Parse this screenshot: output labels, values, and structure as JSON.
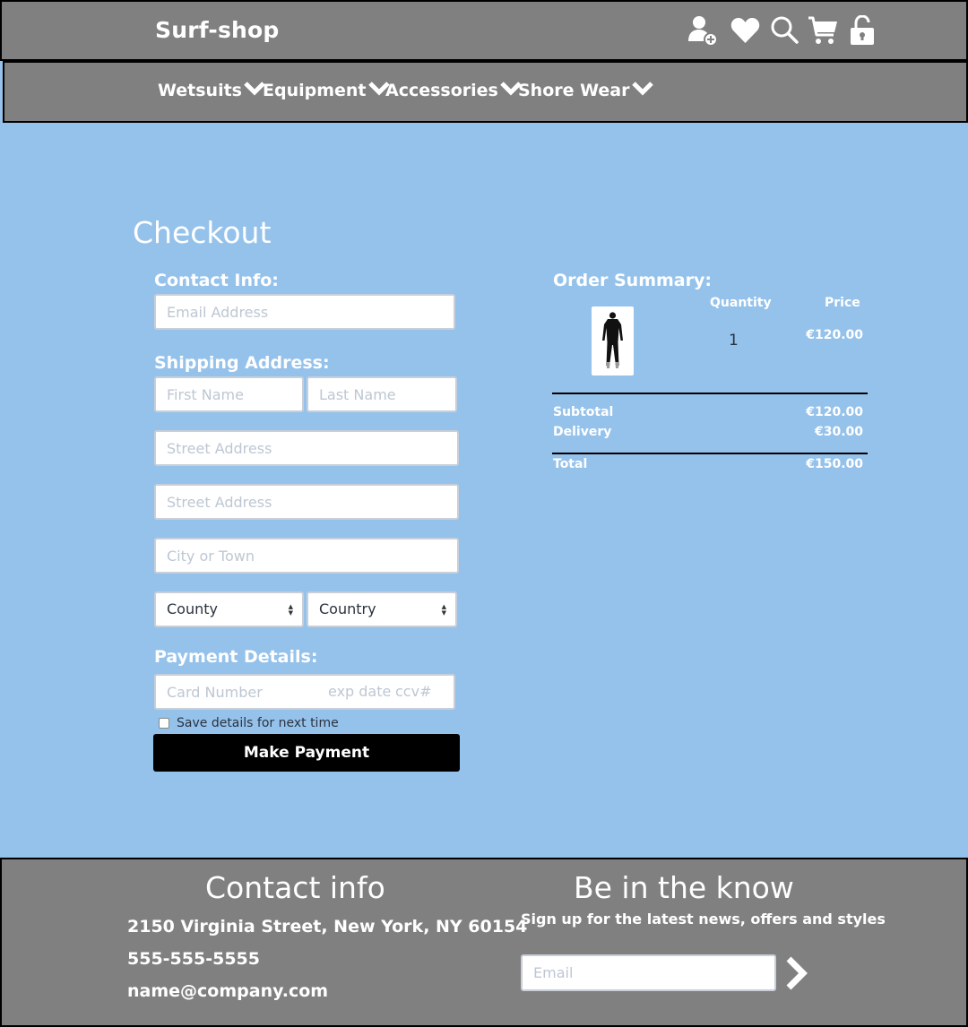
{
  "header": {
    "brand": "Surf-shop",
    "icons": [
      "add-user-icon",
      "heart-icon",
      "search-icon",
      "cart-icon",
      "unlock-icon"
    ]
  },
  "nav": {
    "items": [
      {
        "label": "Wetsuits"
      },
      {
        "label": "Equipment"
      },
      {
        "label": "Accessories"
      },
      {
        "label": "Shore Wear"
      }
    ]
  },
  "checkout": {
    "title": "Checkout",
    "contact_label": "Contact Info:",
    "email_placeholder": "Email Address",
    "shipping_label": "Shipping Address:",
    "first_name_placeholder": "First Name",
    "last_name_placeholder": "Last Name",
    "street1_placeholder": "Street Address",
    "street2_placeholder": "Street Address",
    "city_placeholder": "City or Town",
    "county_select": "County",
    "country_select": "Country",
    "payment_label": "Payment Details:",
    "card_placeholder": "Card Number",
    "exp_placeholder": "exp date",
    "ccv_placeholder": "ccv#",
    "save_details_label": "Save details for next time",
    "pay_button": "Make Payment"
  },
  "summary": {
    "title": "Order Summary:",
    "quantity_header": "Quantity",
    "price_header": "Price",
    "item": {
      "quantity": "1",
      "price": "€120.00",
      "image": "wetsuit-image"
    },
    "subtotal_label": "Subtotal",
    "subtotal_value": "€120.00",
    "delivery_label": "Delivery",
    "delivery_value": "€30.00",
    "total_label": "Total",
    "total_value": "€150.00"
  },
  "footer": {
    "contact_title": "Contact info",
    "address": "2150 Virginia Street, New York, NY 60154",
    "phone": "555-555-5555",
    "email": "name@company.com",
    "newsletter_title": "Be in the know",
    "newsletter_sub": "Sign up for the latest news, offers and styles",
    "email_placeholder": "Email"
  },
  "colors": {
    "background": "#95c2eb",
    "header": "#808080",
    "button": "#000000"
  }
}
